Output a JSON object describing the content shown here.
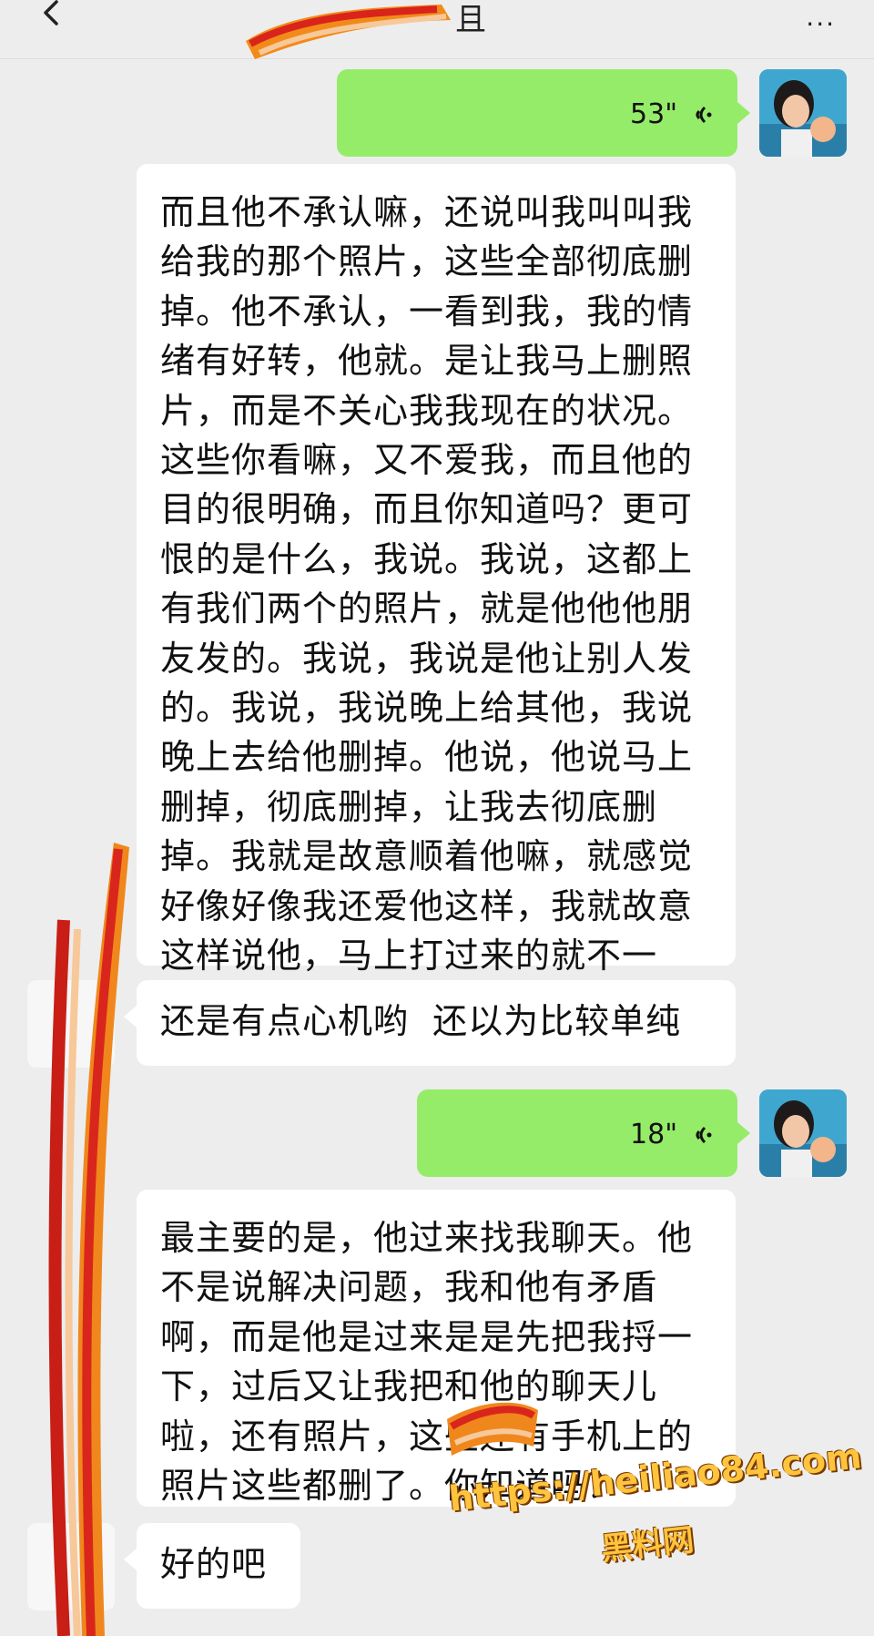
{
  "header": {
    "title": "且",
    "more_label": "···"
  },
  "messages": [
    {
      "side": "out",
      "type": "voice",
      "duration": "53\""
    },
    {
      "side": "in",
      "type": "text",
      "text": "而且他不承认嘛，还说叫我叫叫我给我的那个照片，这些全部彻底删掉。他不承认，一看到我，我的情绪有好转，他就。是让我马上删照片，而是不关心我我现在的状况。这些你看嘛，又不爱我，而且他的目的很明确，而且你知道吗？更可恨的是什么，我说。我说，这都上有我们两个的照片，就是他他他朋友发的。我说，我说是他让别人发的。我说，我说晚上给其他，我说晚上去给他删掉。他说，他说马上删掉，彻底删掉，让我去彻底删掉。我就是故意顺着他嘛，就感觉好像好像我还爱他这样，我就故意这样说他，马上打过来的就不一样。"
    },
    {
      "side": "in",
      "type": "text",
      "text": "还是有点心机哟  还以为比较单纯"
    },
    {
      "side": "out",
      "type": "voice",
      "duration": "18\""
    },
    {
      "side": "in",
      "type": "text",
      "text": "最主要的是，他过来找我聊天。他不是说解决问题，我和他有矛盾啊，而是他是过来是是先把我捋一下，过后又让我把和他的聊天儿啦，还有照片，这些还有手机上的照片这些都删了。你知道吗？"
    },
    {
      "side": "in",
      "type": "text",
      "text": "好的吧"
    }
  ],
  "watermark": {
    "url": "https://heiliao84.com",
    "site_name": "黑料网"
  },
  "colors": {
    "background": "#ededed",
    "incoming_bubble": "#ffffff",
    "outgoing_bubble": "#95ec69"
  }
}
